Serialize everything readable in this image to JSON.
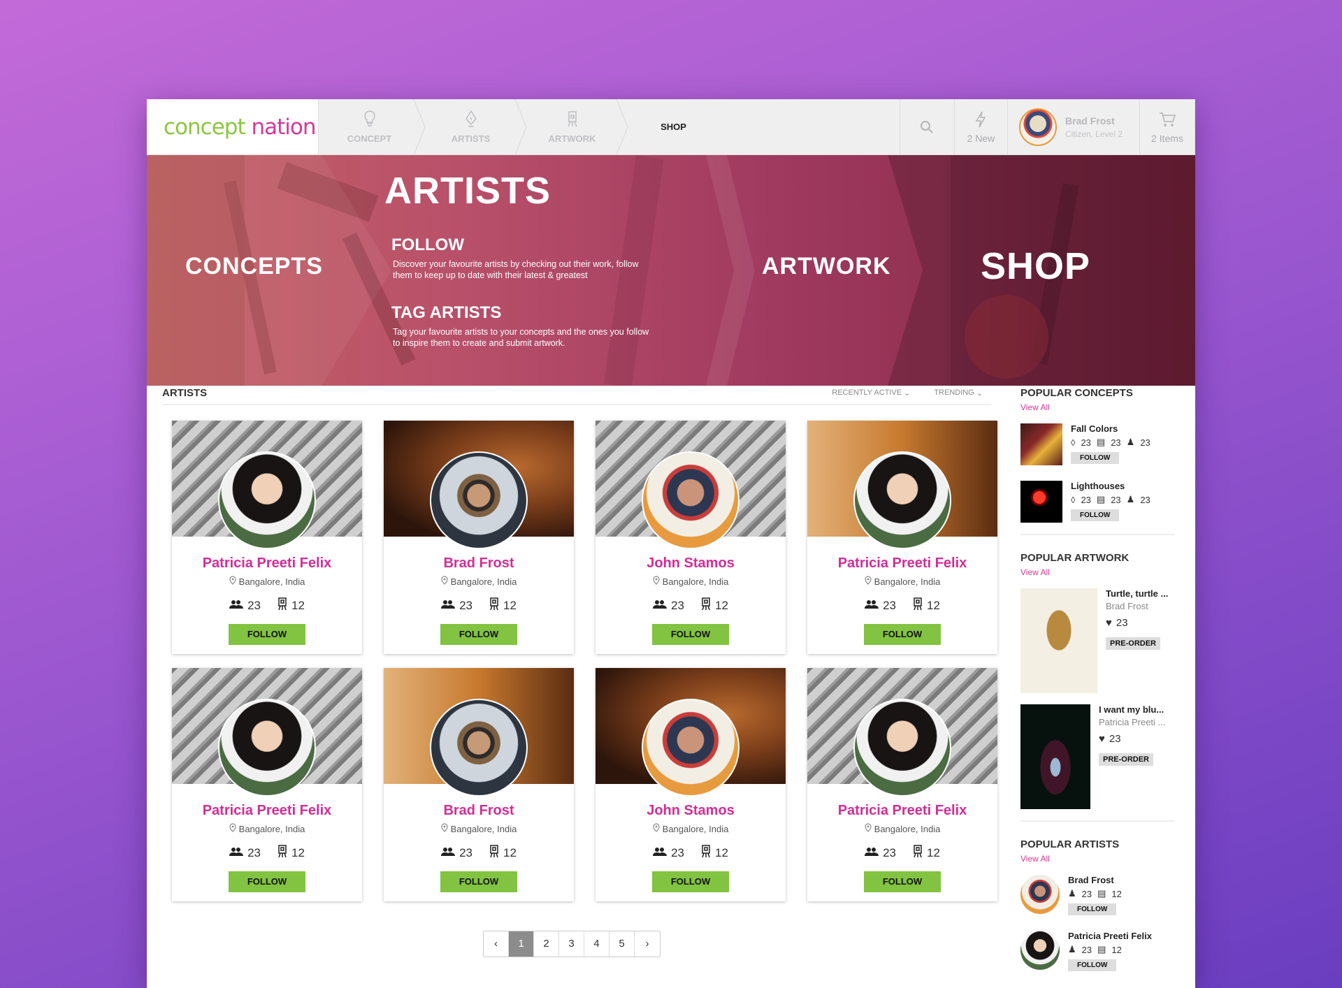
{
  "header": {
    "logo_a": "concept",
    "logo_b": "nation",
    "nav": [
      {
        "label": "CONCEPT",
        "icon": "bulb-icon"
      },
      {
        "label": "ARTISTS",
        "icon": "pen-nib-icon"
      },
      {
        "label": "ARTWORK",
        "icon": "easel-icon"
      },
      {
        "label": "SHOP",
        "icon": ""
      }
    ],
    "notifications": "2 New",
    "user_name": "Brad Frost",
    "user_level": "Citizen, Level 2",
    "cart": "2 Items"
  },
  "hero": {
    "concepts": "CONCEPTS",
    "artists": "ARTISTS",
    "follow_title": "FOLLOW",
    "follow_desc": "Discover your favourite artists by checking out their work, follow them to keep up to date with their latest & greatest",
    "tag_title": "TAG ARTISTS",
    "tag_desc": "Tag your favourite artists to your concepts and the ones you follow to inspire them to create and submit artwork.",
    "artwork": "ARTWORK",
    "shop": "SHOP"
  },
  "artists_section": {
    "title": "ARTISTS",
    "sort_recent": "RECENTLY ACTIVE",
    "sort_trending": "TRENDING",
    "follow_label": "FOLLOW",
    "cards": [
      {
        "name": "Patricia Preeti Felix",
        "location": "Bangalore, India",
        "followers": "23",
        "artworks": "12"
      },
      {
        "name": "Brad Frost",
        "location": "Bangalore, India",
        "followers": "23",
        "artworks": "12"
      },
      {
        "name": "John Stamos",
        "location": "Bangalore, India",
        "followers": "23",
        "artworks": "12"
      },
      {
        "name": "Patricia Preeti Felix",
        "location": "Bangalore, India",
        "followers": "23",
        "artworks": "12"
      },
      {
        "name": "Patricia Preeti Felix",
        "location": "Bangalore, India",
        "followers": "23",
        "artworks": "12"
      },
      {
        "name": "Brad Frost",
        "location": "Bangalore, India",
        "followers": "23",
        "artworks": "12"
      },
      {
        "name": "John Stamos",
        "location": "Bangalore, India",
        "followers": "23",
        "artworks": "12"
      },
      {
        "name": "Patricia Preeti Felix",
        "location": "Bangalore, India",
        "followers": "23",
        "artworks": "12"
      }
    ],
    "pages": [
      "1",
      "2",
      "3",
      "4",
      "5"
    ],
    "prev": "‹",
    "next": "›"
  },
  "sidebar": {
    "view_all": "View All",
    "follow_label": "FOLLOW",
    "preorder_label": "PRE-ORDER",
    "popular_concepts": {
      "title": "POPULAR CONCEPTS",
      "items": [
        {
          "name": "Fall Colors",
          "a": "23",
          "b": "23",
          "c": "23"
        },
        {
          "name": "Lighthouses",
          "a": "23",
          "b": "23",
          "c": "23"
        }
      ]
    },
    "popular_artwork": {
      "title": "POPULAR ARTWORK",
      "items": [
        {
          "name": "Turtle, turtle ...",
          "artist": "Brad Frost",
          "likes": "23"
        },
        {
          "name": "I want my blu...",
          "artist": "Patricia Preeti ...",
          "likes": "23"
        }
      ]
    },
    "popular_artists": {
      "title": "POPULAR ARTISTS",
      "items": [
        {
          "name": "Brad Frost",
          "followers": "23",
          "artworks": "12"
        },
        {
          "name": "Patricia Preeti Felix",
          "followers": "23",
          "artworks": "12"
        }
      ]
    }
  },
  "colors": {
    "accent_pink": "#d32d96",
    "follow_green": "#82c341",
    "hero_title_yellow": "#f4ea1b"
  }
}
